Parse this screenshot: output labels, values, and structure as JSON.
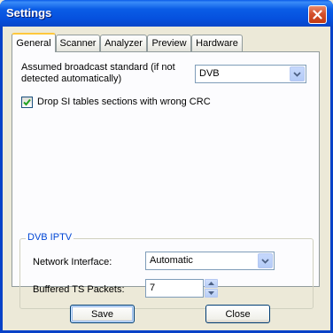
{
  "window": {
    "title": "Settings"
  },
  "tabs": [
    "General",
    "Scanner",
    "Analyzer",
    "Preview",
    "Hardware"
  ],
  "general": {
    "broadcast_label_line1": "Assumed broadcast standard (if not",
    "broadcast_label_line2": "detected automatically)",
    "broadcast_value": "DVB",
    "drop_si_label": "Drop SI tables sections with wrong CRC",
    "drop_si_checked": true
  },
  "dvb_iptv": {
    "group_title": "DVB IPTV",
    "network_interface_label": "Network Interface:",
    "network_interface_value": "Automatic",
    "buffered_label": "Buffered TS Packets:",
    "buffered_value": "7"
  },
  "buttons": {
    "save": "Save",
    "close": "Close"
  },
  "icons": [
    "close-icon",
    "chevron-down-icon",
    "checkmark-icon",
    "arrow-up-icon",
    "arrow-down-icon"
  ]
}
